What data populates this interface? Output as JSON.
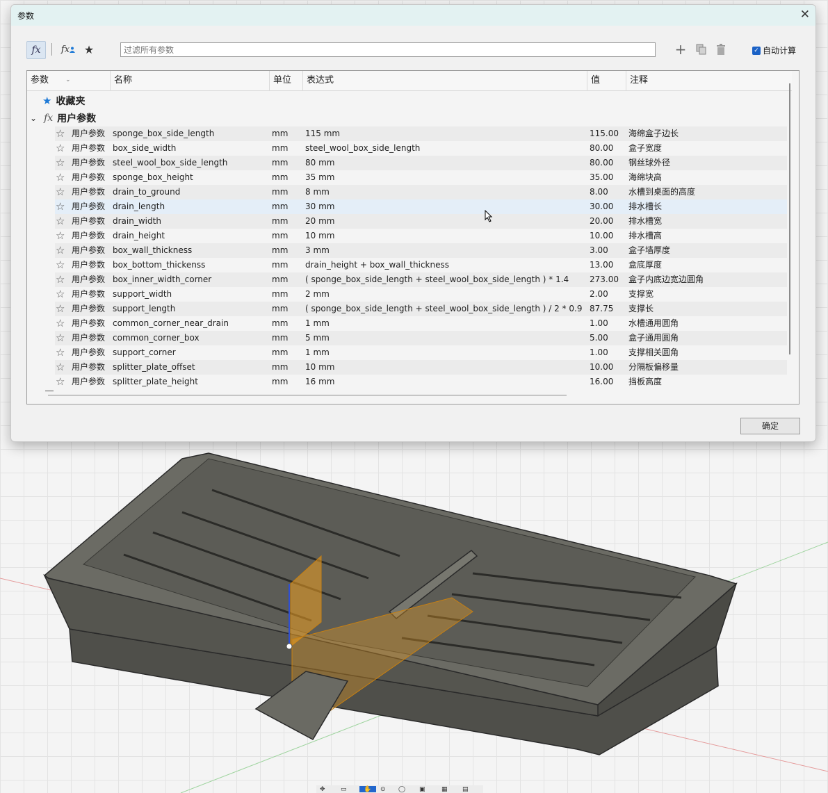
{
  "dialog": {
    "title": "参数",
    "close_glyph": "✕",
    "filter_placeholder": "过滤所有参数",
    "auto_calc_label": "自动计算",
    "ok_label": "确定"
  },
  "toolbar": {
    "fx_glyph": "fx",
    "fx_user_glyph": "fx",
    "favorite_glyph": "★",
    "add_glyph": "+",
    "icons": [
      "fx-icon",
      "user-parameter-icon",
      "star-icon",
      "add-icon",
      "copy-icon",
      "delete-icon"
    ]
  },
  "table": {
    "headers": {
      "param": "参数",
      "name": "名称",
      "unit": "单位",
      "expression": "表达式",
      "value": "值",
      "comment": "注释"
    },
    "groups": {
      "favorites": "收藏夹",
      "user": "用户参数",
      "fav_star": "★",
      "fx": "fx",
      "expander": "⌄"
    },
    "row_star": "☆",
    "rows": [
      {
        "type": "用户参数",
        "name": "sponge_box_side_length",
        "unit": "mm",
        "expr": "115 mm",
        "value": "115.00",
        "note": "海绵盒子边长"
      },
      {
        "type": "用户参数",
        "name": "box_side_width",
        "unit": "mm",
        "expr": "steel_wool_box_side_length",
        "value": "80.00",
        "note": "盒子宽度"
      },
      {
        "type": "用户参数",
        "name": "steel_wool_box_side_length",
        "unit": "mm",
        "expr": "80 mm",
        "value": "80.00",
        "note": "钢丝球外径"
      },
      {
        "type": "用户参数",
        "name": "sponge_box_height",
        "unit": "mm",
        "expr": "35 mm",
        "value": "35.00",
        "note": "海绵块高"
      },
      {
        "type": "用户参数",
        "name": "drain_to_ground",
        "unit": "mm",
        "expr": "8 mm",
        "value": "8.00",
        "note": "水槽到桌面的高度"
      },
      {
        "type": "用户参数",
        "name": "drain_length",
        "unit": "mm",
        "expr": "30 mm",
        "value": "30.00",
        "note": "排水槽长"
      },
      {
        "type": "用户参数",
        "name": "drain_width",
        "unit": "mm",
        "expr": "20 mm",
        "value": "20.00",
        "note": "排水槽宽"
      },
      {
        "type": "用户参数",
        "name": "drain_height",
        "unit": "mm",
        "expr": "10 mm",
        "value": "10.00",
        "note": "排水槽高"
      },
      {
        "type": "用户参数",
        "name": "box_wall_thickness",
        "unit": "mm",
        "expr": "3 mm",
        "value": "3.00",
        "note": "盒子墙厚度"
      },
      {
        "type": "用户参数",
        "name": "box_bottom_thickenss",
        "unit": "mm",
        "expr": "drain_height + box_wall_thickness",
        "value": "13.00",
        "note": "盒底厚度"
      },
      {
        "type": "用户参数",
        "name": "box_inner_width_corner",
        "unit": "mm",
        "expr": "( sponge_box_side_length + steel_wool_box_side_length ) * 1.4",
        "value": "273.00",
        "note": "盒子内底边宽边圆角"
      },
      {
        "type": "用户参数",
        "name": "support_width",
        "unit": "mm",
        "expr": "2 mm",
        "value": "2.00",
        "note": "支撑宽"
      },
      {
        "type": "用户参数",
        "name": "support_length",
        "unit": "mm",
        "expr": "( sponge_box_side_length + steel_wool_box_side_length ) / 2 * 0.9",
        "value": "87.75",
        "note": "支撑长"
      },
      {
        "type": "用户参数",
        "name": "common_corner_near_drain",
        "unit": "mm",
        "expr": "1 mm",
        "value": "1.00",
        "note": "水槽通用圆角"
      },
      {
        "type": "用户参数",
        "name": "common_corner_box",
        "unit": "mm",
        "expr": "5 mm",
        "value": "5.00",
        "note": "盒子通用圆角"
      },
      {
        "type": "用户参数",
        "name": "support_corner",
        "unit": "mm",
        "expr": "1 mm",
        "value": "1.00",
        "note": "支撑相关圆角"
      },
      {
        "type": "用户参数",
        "name": "splitter_plate_offset",
        "unit": "mm",
        "expr": "10 mm",
        "value": "10.00",
        "note": "分隔板偏移量"
      },
      {
        "type": "用户参数",
        "name": "splitter_plate_height",
        "unit": "mm",
        "expr": "16 mm",
        "value": "16.00",
        "note": "挡板高度"
      }
    ]
  },
  "colors": {
    "title_bar": "#e3f2f2",
    "selection": "#e4eef8",
    "accent": "#1b62c6",
    "model_body": "#5e5e58",
    "highlight": "#f0a020"
  }
}
